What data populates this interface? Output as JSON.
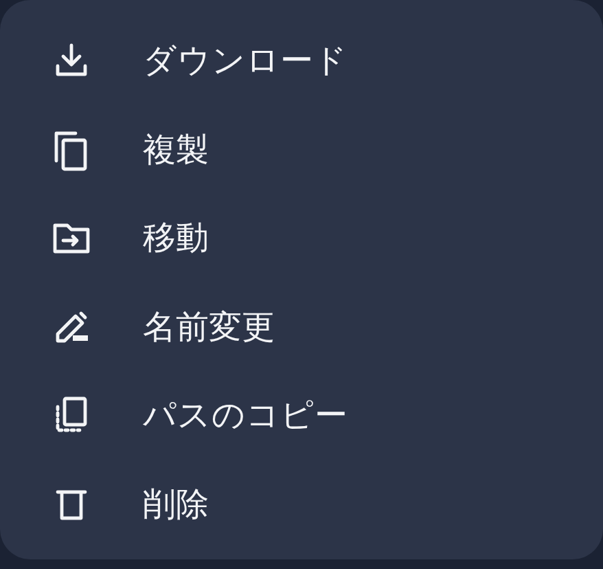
{
  "menu": {
    "items": [
      {
        "kind": "download",
        "label": "ダウンロード"
      },
      {
        "kind": "duplicate",
        "label": "複製"
      },
      {
        "kind": "move",
        "label": "移動"
      },
      {
        "kind": "rename",
        "label": "名前変更"
      },
      {
        "kind": "copy-path",
        "label": "パスのコピー"
      },
      {
        "kind": "delete",
        "label": "削除"
      }
    ]
  }
}
